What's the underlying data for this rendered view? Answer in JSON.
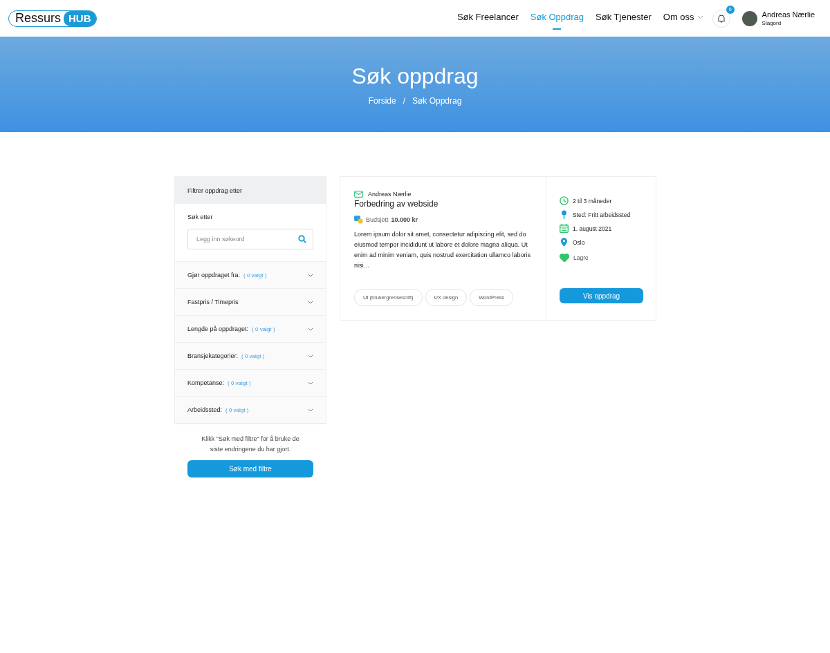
{
  "logo": {
    "word": "Ressurs",
    "badge": "HUB"
  },
  "nav": [
    {
      "label": "Søk Freelancer",
      "selected": false,
      "dropdown": false
    },
    {
      "label": "Søk Oppdrag",
      "selected": true,
      "dropdown": false
    },
    {
      "label": "Søk Tjenester",
      "selected": false,
      "dropdown": false
    },
    {
      "label": "Om oss",
      "selected": false,
      "dropdown": true
    }
  ],
  "notifications": {
    "count": "0"
  },
  "user": {
    "name": "Andreas Nærlie",
    "subtitle": "Slagord"
  },
  "hero": {
    "title": "Søk oppdrag",
    "breadcrumb": [
      "Forside",
      "Søk Oppdrag"
    ],
    "separator": "/"
  },
  "filter": {
    "heading": "Filtrer oppdrag etter",
    "search_label": "Søk etter",
    "search": {
      "placeholder": "Legg inn søkeord"
    },
    "groups": [
      {
        "label": "Gjør oppdraget fra:",
        "count": "( 0 valgt )"
      },
      {
        "label": "Fastpris / Timepris"
      },
      {
        "label": "Lengde på oppdraget:",
        "count": "( 0 valgt )"
      },
      {
        "label": "Bransjekategorier:",
        "count": "( 0 valgt )"
      },
      {
        "label": "Kompetanse:",
        "count": "( 0 valgt )"
      },
      {
        "label": "Arbeidssted:",
        "count": "( 0 valgt )"
      }
    ],
    "hint": "Klikk \"Søk med filtre\" for å bruke de siste endringene du har gjort.",
    "button": "Søk med filtre"
  },
  "jobs": [
    {
      "author": "Andreas Nærlie",
      "title": "Forbedring av webside",
      "budget_label": "Budsjett",
      "budget": "10.000 kr",
      "description": "Lorem ipsum dolor sit amet, consectetur adipiscing elit, sed do eiusmod tempor incididunt ut labore et dolore magna aliqua. Ut enim ad minim veniam, quis nostrud exercitation ullamco laboris nisi…",
      "tags": [
        "UI (brukergrensesnitt)",
        "UX design",
        "WordPress"
      ],
      "details": [
        {
          "kind": "duration",
          "text": "2 til 3 måneder"
        },
        {
          "kind": "place",
          "text": "Sted: Fritt arbeidssted"
        },
        {
          "kind": "date",
          "text": "1. august 2021"
        },
        {
          "kind": "location",
          "text": "Oslo"
        }
      ],
      "save": {
        "label": "Lagre",
        "saved": true
      },
      "button": "Vis oppdrag"
    }
  ]
}
